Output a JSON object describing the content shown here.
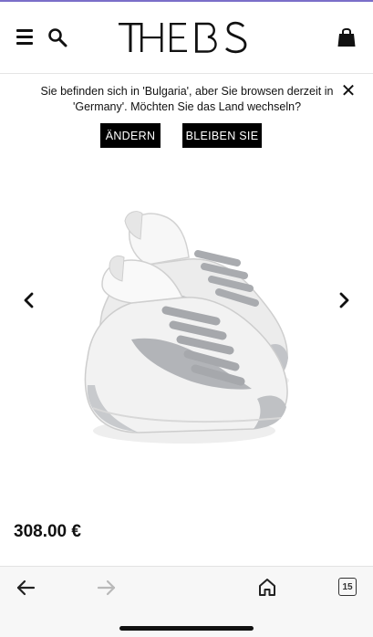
{
  "header": {
    "logo_text": "THEBS",
    "icons": {
      "menu": "hamburger-icon",
      "search": "search-icon",
      "bag": "shopping-bag-icon"
    }
  },
  "banner": {
    "message": "Sie befinden sich in 'Bulgaria', aber Sie browsen derzeit in 'Germany'. Möchten Sie das Land wechseln?",
    "change_label": "ÄNDERN",
    "stay_label": "BLEIBEN SIE",
    "close_icon": "close-icon"
  },
  "product": {
    "image_icon": "product-photo-white-sneakers",
    "price": "308.00 €"
  },
  "browser_toolbar": {
    "tab_count": "15",
    "icons": {
      "back": "back-arrow-icon",
      "forward": "forward-arrow-icon",
      "home": "home-icon",
      "tabs": "tabs-icon"
    }
  },
  "colors": {
    "accent_bar": "#7b6fc9",
    "button_bg": "#000000",
    "toolbar_bg": "#f7f7f7"
  }
}
